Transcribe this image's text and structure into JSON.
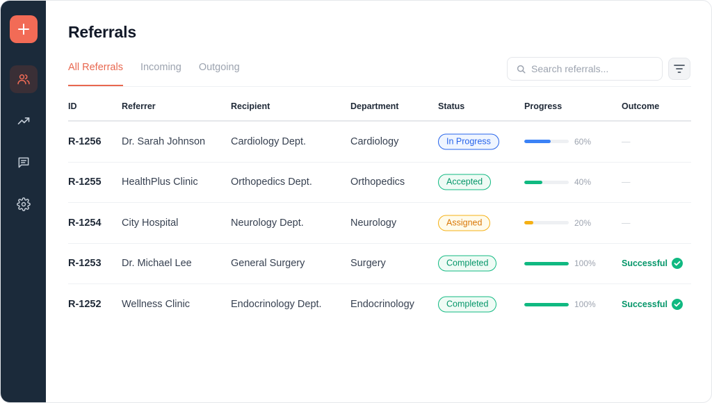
{
  "sidebar": {
    "add_icon": "plus-icon",
    "items": [
      {
        "icon": "users-icon",
        "active": true
      },
      {
        "icon": "trending-up-icon",
        "active": false
      },
      {
        "icon": "message-icon",
        "active": false
      },
      {
        "icon": "gear-icon",
        "active": false
      }
    ]
  },
  "header": {
    "title": "Referrals"
  },
  "tabs": [
    {
      "label": "All Referrals",
      "active": true
    },
    {
      "label": "Incoming",
      "active": false
    },
    {
      "label": "Outgoing",
      "active": false
    }
  ],
  "search": {
    "placeholder": "Search referrals...",
    "value": ""
  },
  "table": {
    "columns": [
      "ID",
      "Referrer",
      "Recipient",
      "Department",
      "Status",
      "Progress",
      "Outcome"
    ],
    "rows": [
      {
        "id": "R-1256",
        "referrer": "Dr. Sarah Johnson",
        "recipient": "Cardiology Dept.",
        "department": "Cardiology",
        "status": "In Progress",
        "status_kind": "progress",
        "progress": 60,
        "progress_label": "60%",
        "outcome": "—",
        "outcome_success": false
      },
      {
        "id": "R-1255",
        "referrer": "HealthPlus Clinic",
        "recipient": "Orthopedics Dept.",
        "department": "Orthopedics",
        "status": "Accepted",
        "status_kind": "accepted",
        "progress": 40,
        "progress_label": "40%",
        "outcome": "—",
        "outcome_success": false
      },
      {
        "id": "R-1254",
        "referrer": "City Hospital",
        "recipient": "Neurology Dept.",
        "department": "Neurology",
        "status": "Assigned",
        "status_kind": "assigned",
        "progress": 20,
        "progress_label": "20%",
        "outcome": "—",
        "outcome_success": false
      },
      {
        "id": "R-1253",
        "referrer": "Dr. Michael Lee",
        "recipient": "General Surgery",
        "department": "Surgery",
        "status": "Completed",
        "status_kind": "completed",
        "progress": 100,
        "progress_label": "100%",
        "outcome": "Successful",
        "outcome_success": true
      },
      {
        "id": "R-1252",
        "referrer": "Wellness Clinic",
        "recipient": "Endocrinology Dept.",
        "department": "Endocrinology",
        "status": "Completed",
        "status_kind": "completed",
        "progress": 100,
        "progress_label": "100%",
        "outcome": "Successful",
        "outcome_success": true
      }
    ]
  },
  "colors": {
    "accent": "#e8674f",
    "sidebar_bg": "#1b2a3a",
    "progress_blue": "#3b82f6",
    "progress_green": "#10b981",
    "progress_amber": "#f5b014",
    "success": "#10b981"
  }
}
